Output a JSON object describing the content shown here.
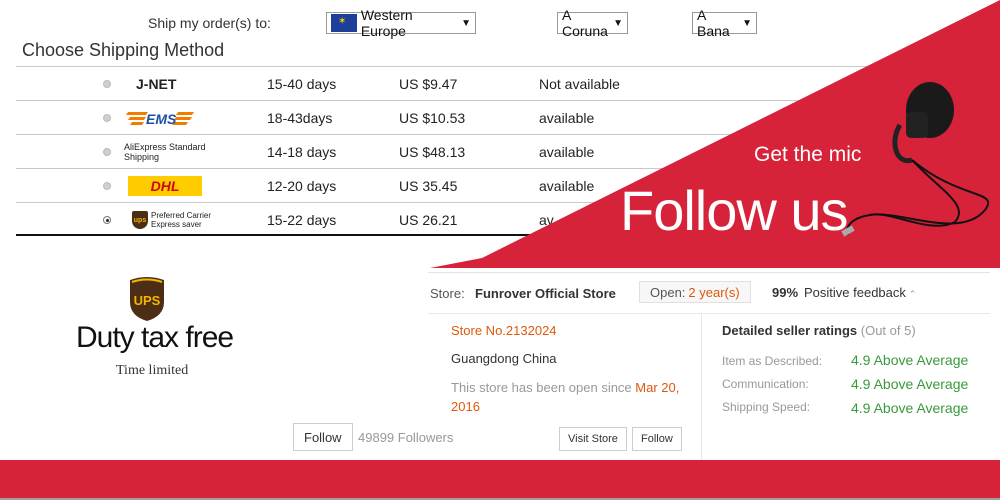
{
  "shipping": {
    "ship_to_label": "Ship my order(s) to:",
    "country": "Western Europe",
    "region": "A Coruna",
    "city": "A Bana",
    "section_title": "Choose Shipping Method",
    "rows": [
      {
        "carrier": "J-NET",
        "days": "15-40 days",
        "price": "US $9.47",
        "availability": "Not available",
        "selected": false
      },
      {
        "carrier": "EMS",
        "days": "18-43days",
        "price": "US $10.53",
        "availability": "available",
        "selected": false
      },
      {
        "carrier": "AliExpress Standard Shipping",
        "days": "14-18 days",
        "price": "US $48.13",
        "availability": "available",
        "selected": false
      },
      {
        "carrier": "DHL",
        "days": "12-20 days",
        "price": "US 35.45",
        "availability": "available",
        "selected": false
      },
      {
        "carrier": "Preferred Carrier Express saver",
        "days": "15-22 days",
        "price": "US 26.21",
        "availability": "av",
        "selected": true
      }
    ]
  },
  "banner": {
    "tagline": "Get the mic",
    "headline": "Follow us",
    "accent_color": "#d6233a"
  },
  "promo": {
    "logo_text": "UPS",
    "duty": "Duty tax free",
    "time_limited": "Time limited"
  },
  "store": {
    "label": "Store:",
    "name": "Funrover Official Store",
    "open_label": "Open:",
    "open_years": "2 year(s)",
    "feedback_pct": "99%",
    "feedback_label": "Positive feedback",
    "store_no": "Store No.2132024",
    "location": "Guangdong China",
    "open_since_text": "This store has been open since",
    "open_since_date": "Mar 20, 2016",
    "follow_label": "Follow",
    "followers": "49899 Followers",
    "visit_label": "Visit Store",
    "follow_small_label": "Follow",
    "ratings_title": "Detailed seller ratings",
    "ratings_sub": "(Out of 5)",
    "ratings": [
      {
        "label": "Item as Described:",
        "value": "4.9 Above Average"
      },
      {
        "label": "Communication:",
        "value": "4.9 Above Average"
      },
      {
        "label": "Shipping Speed:",
        "value": "4.9 Above Average"
      }
    ]
  }
}
